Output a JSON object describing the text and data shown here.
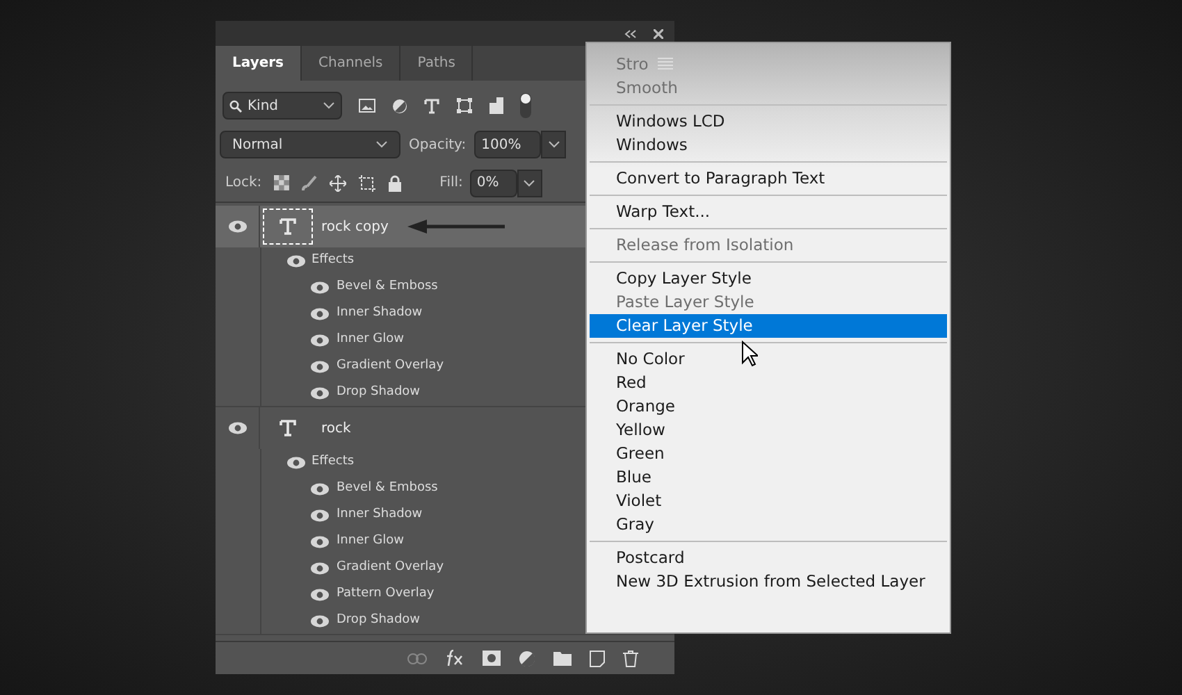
{
  "panel": {
    "tabs": [
      {
        "label": "Layers",
        "selected": true
      },
      {
        "label": "Channels",
        "selected": false
      },
      {
        "label": "Paths",
        "selected": false
      }
    ],
    "filter": {
      "value": "Kind"
    },
    "blend_mode": "Normal",
    "opacity_label": "Opacity:",
    "opacity": "100%",
    "lock_label": "Lock:",
    "fill_label": "Fill:",
    "fill": "0%",
    "layers": [
      {
        "name": "rock copy",
        "selected": true,
        "visible": true,
        "effects_label": "Effects",
        "effects": [
          {
            "name": "Bevel & Emboss",
            "visible": true
          },
          {
            "name": "Inner Shadow",
            "visible": true
          },
          {
            "name": "Inner Glow",
            "visible": true
          },
          {
            "name": "Gradient Overlay",
            "visible": true
          },
          {
            "name": "Drop Shadow",
            "visible": true
          }
        ]
      },
      {
        "name": "rock",
        "selected": false,
        "visible": true,
        "effects_label": "Effects",
        "effects": [
          {
            "name": "Bevel & Emboss",
            "visible": true
          },
          {
            "name": "Inner Shadow",
            "visible": true
          },
          {
            "name": "Inner Glow",
            "visible": true
          },
          {
            "name": "Gradient Overlay",
            "visible": true
          },
          {
            "name": "Pattern Overlay",
            "visible": true
          },
          {
            "name": "Drop Shadow",
            "visible": true
          }
        ]
      }
    ]
  },
  "menu": {
    "groups": [
      [
        {
          "label": "Stro",
          "disabled": true,
          "selected": false
        },
        {
          "label": "Smooth",
          "disabled": true,
          "selected": false
        }
      ],
      [
        {
          "label": "Windows LCD",
          "disabled": false,
          "selected": false
        },
        {
          "label": "Windows",
          "disabled": false,
          "selected": false
        }
      ],
      [
        {
          "label": "Convert to Paragraph Text",
          "disabled": false,
          "selected": false
        }
      ],
      [
        {
          "label": "Warp Text...",
          "disabled": false,
          "selected": false
        }
      ],
      [
        {
          "label": "Release from Isolation",
          "disabled": true,
          "selected": false
        }
      ],
      [
        {
          "label": "Copy Layer Style",
          "disabled": false,
          "selected": false
        },
        {
          "label": "Paste Layer Style",
          "disabled": true,
          "selected": false
        },
        {
          "label": "Clear Layer Style",
          "disabled": false,
          "selected": true
        }
      ],
      [
        {
          "label": "No Color",
          "disabled": false,
          "selected": false
        },
        {
          "label": "Red",
          "disabled": false,
          "selected": false
        },
        {
          "label": "Orange",
          "disabled": false,
          "selected": false
        },
        {
          "label": "Yellow",
          "disabled": false,
          "selected": false
        },
        {
          "label": "Green",
          "disabled": false,
          "selected": false
        },
        {
          "label": "Blue",
          "disabled": false,
          "selected": false
        },
        {
          "label": "Violet",
          "disabled": false,
          "selected": false
        },
        {
          "label": "Gray",
          "disabled": false,
          "selected": false
        }
      ],
      [
        {
          "label": "Postcard",
          "disabled": false,
          "selected": false
        },
        {
          "label": "New 3D Extrusion from Selected Layer",
          "disabled": false,
          "selected": false
        }
      ]
    ]
  }
}
